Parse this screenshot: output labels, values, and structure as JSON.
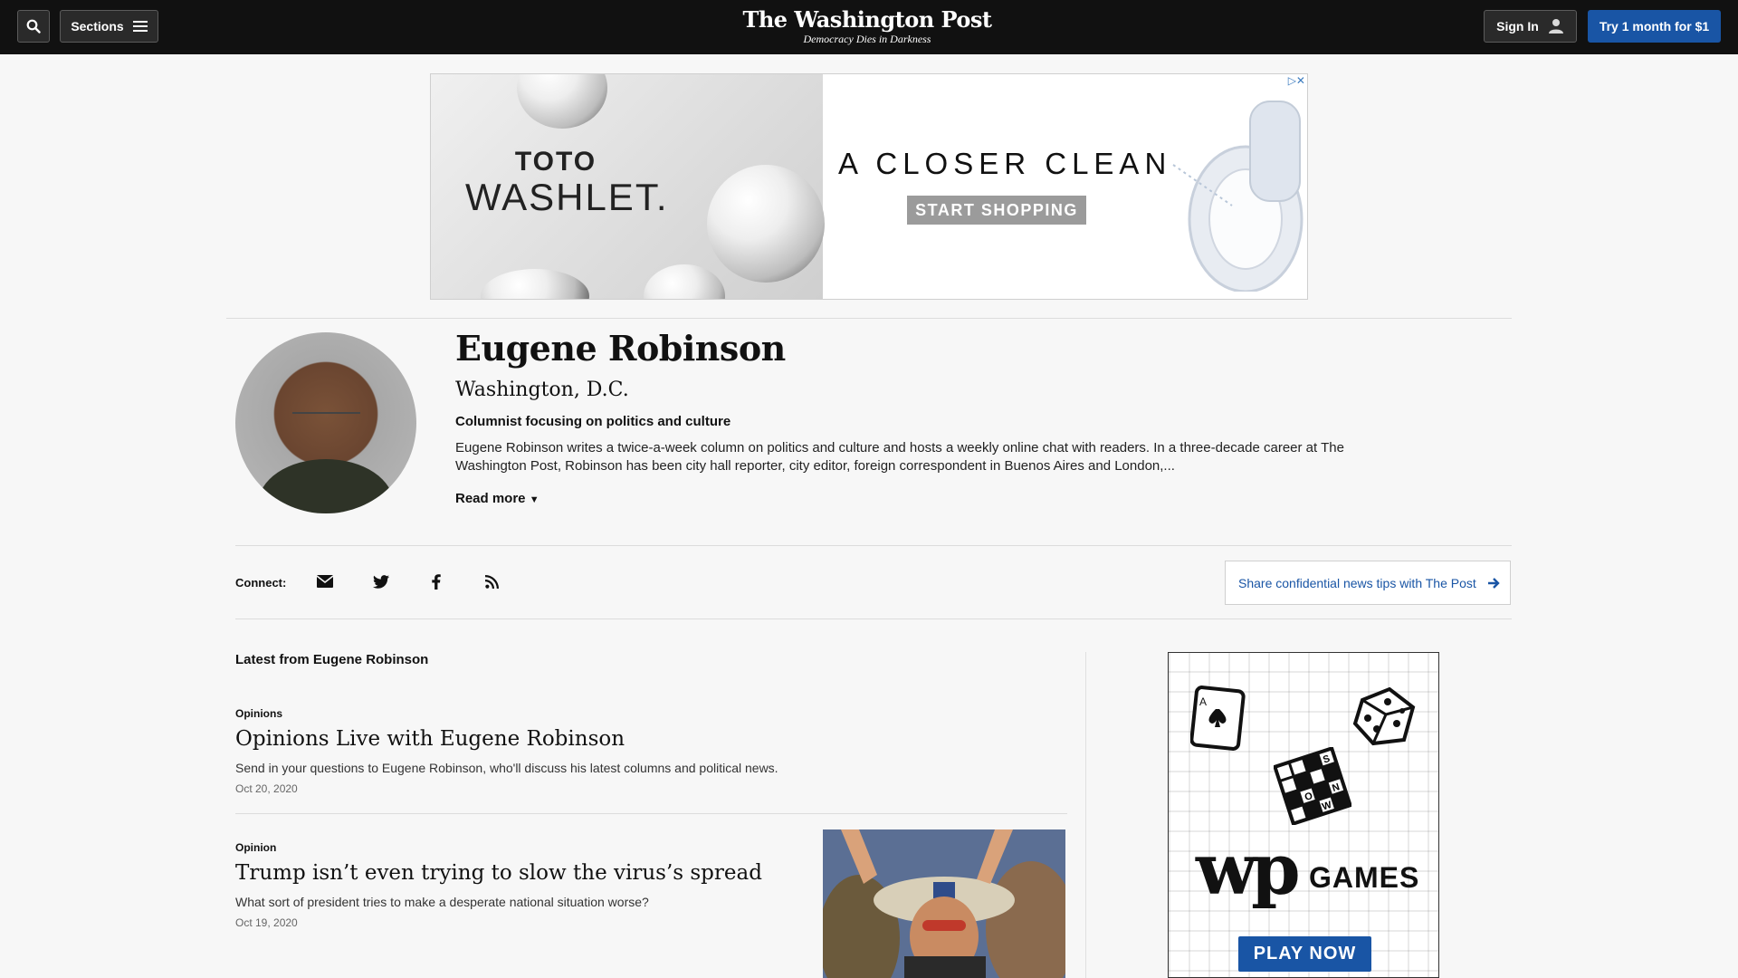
{
  "topbar": {
    "sections_label": "Sections",
    "signin_label": "Sign In",
    "try_label": "Try 1 month for $1",
    "masthead": "The Washington Post",
    "tagline": "Democracy Dies in Darkness"
  },
  "banner_ad": {
    "brand_line1": "TOTO",
    "brand_line2": "WASHLET.",
    "headline": "A CLOSER CLEAN",
    "cta": "START SHOPPING"
  },
  "author": {
    "name": "Eugene Robinson",
    "location": "Washington, D.C.",
    "role": "Columnist focusing on politics and culture",
    "bio": "Eugene Robinson writes a twice-a-week column on politics and culture and hosts a weekly online chat with readers. In a three-decade career at The Washington Post, Robinson has been city hall reporter, city editor, foreign correspondent in Buenos Aires and London,...",
    "read_more": "Read more"
  },
  "connect": {
    "label": "Connect:",
    "icons": [
      "email-icon",
      "twitter-icon",
      "facebook-icon",
      "rss-icon"
    ],
    "tips_label": "Share confidential news tips with The Post"
  },
  "latest": {
    "title": "Latest from Eugene Robinson",
    "items": [
      {
        "kicker": "Opinions",
        "headline": "Opinions Live with Eugene Robinson",
        "blurb": "Send in your questions to Eugene Robinson, who'll discuss his latest columns and political news.",
        "date": "Oct 20, 2020"
      },
      {
        "kicker": "Opinion",
        "headline": "Trump isn’t even trying to slow the virus’s spread",
        "blurb": "What sort of president tries to make a desperate national situation worse?",
        "date": "Oct 19, 2020"
      }
    ]
  },
  "side_ad": {
    "logo": "wp",
    "games_label": "GAMES",
    "play_label": "PLAY NOW",
    "crossword_letters": [
      "S",
      "N",
      "O",
      "W"
    ],
    "card_letter": "A"
  },
  "colors": {
    "topbar": "#111111",
    "accent": "#1955a5",
    "page_bg": "#f7f7f7"
  }
}
